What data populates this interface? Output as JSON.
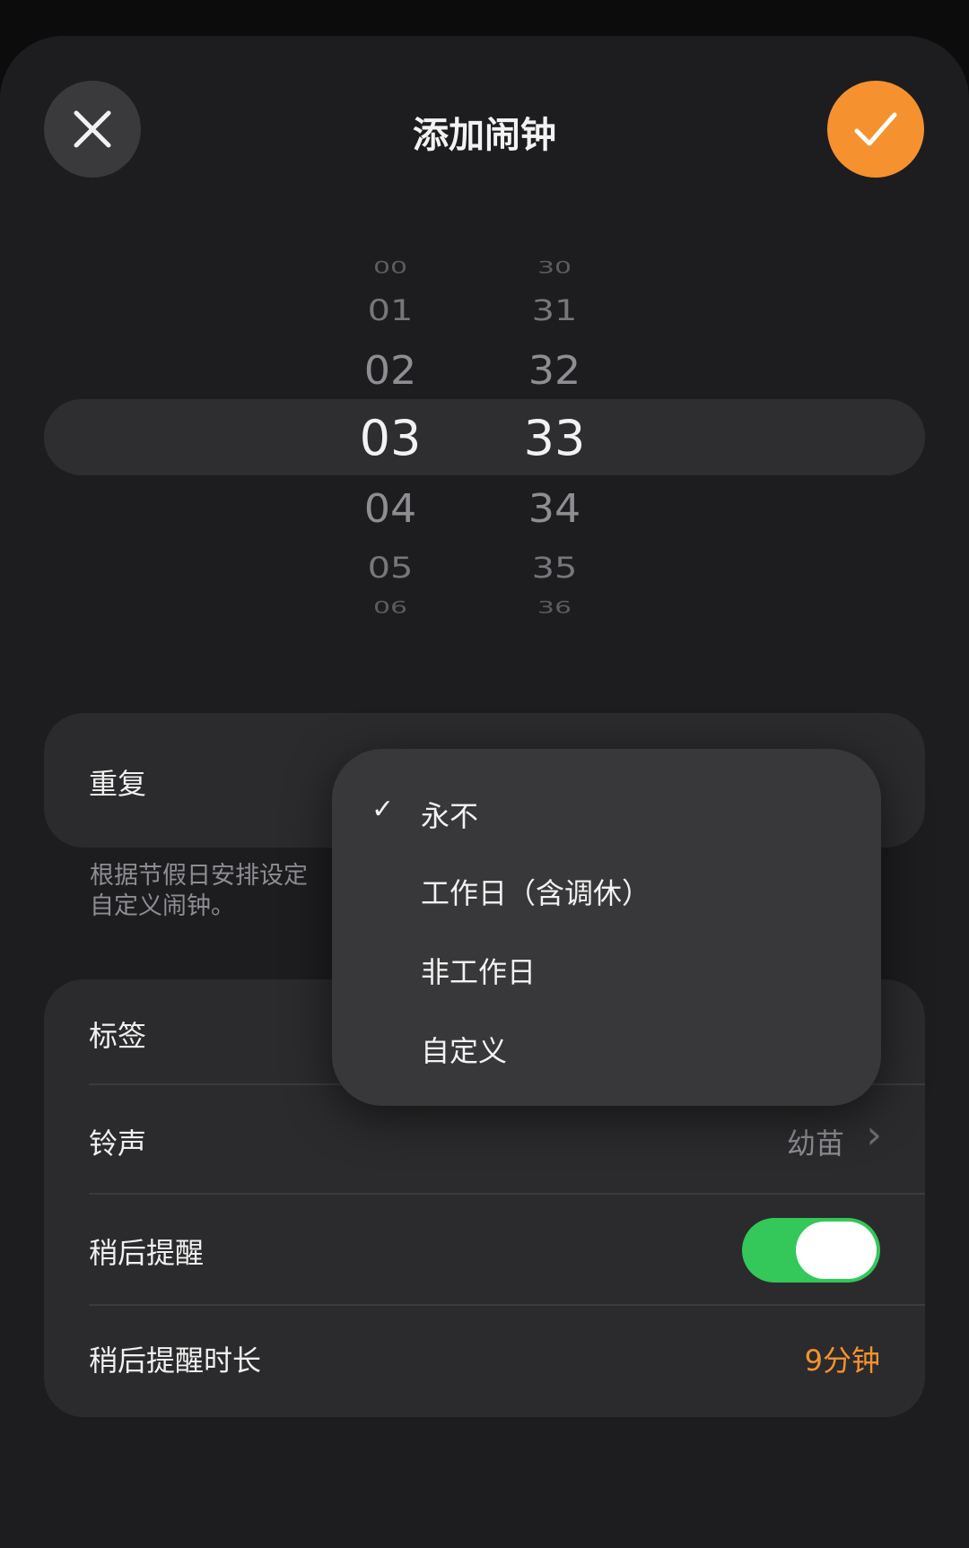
{
  "header": {
    "title": "添加闹钟",
    "close_icon": "close-icon",
    "confirm_icon": "checkmark-icon",
    "confirm_color": "#f5922f"
  },
  "time_picker": {
    "hours": [
      "00",
      "01",
      "02",
      "03",
      "04",
      "05",
      "06"
    ],
    "minutes": [
      "30",
      "31",
      "32",
      "33",
      "34",
      "35",
      "36"
    ],
    "selected_hour": "03",
    "selected_minute": "33"
  },
  "repeat": {
    "label": "重复",
    "hint": "根据节假日安排设定",
    "hint_line2": "自定义闹钟。"
  },
  "repeat_menu": {
    "options": [
      "永不",
      "工作日（含调休）",
      "非工作日",
      "自定义"
    ],
    "selected": "永不",
    "check_glyph": "✓"
  },
  "settings": {
    "label_row": "标签",
    "ringtone_label": "铃声",
    "ringtone_value": "幼苗",
    "ringtone_chevron": "›",
    "snooze_label": "稍后提醒",
    "snooze_enabled": true,
    "snooze_duration_label": "稍后提醒时长",
    "snooze_duration_value": "9分钟"
  },
  "colors": {
    "accent": "#f5922f",
    "toggle_on": "#34c759"
  }
}
